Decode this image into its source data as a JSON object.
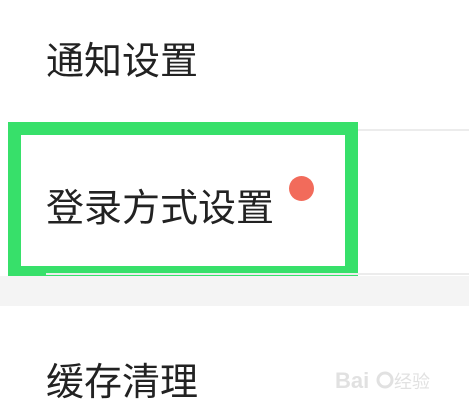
{
  "settings": {
    "items": [
      {
        "label": "通知设置"
      },
      {
        "label": "登录方式设置",
        "has_dot": true
      },
      {
        "label": "缓存清理"
      }
    ]
  },
  "colors": {
    "highlight": "#37e06a",
    "badge_dot": "#f26b5b"
  },
  "watermark": "Baidu经验"
}
